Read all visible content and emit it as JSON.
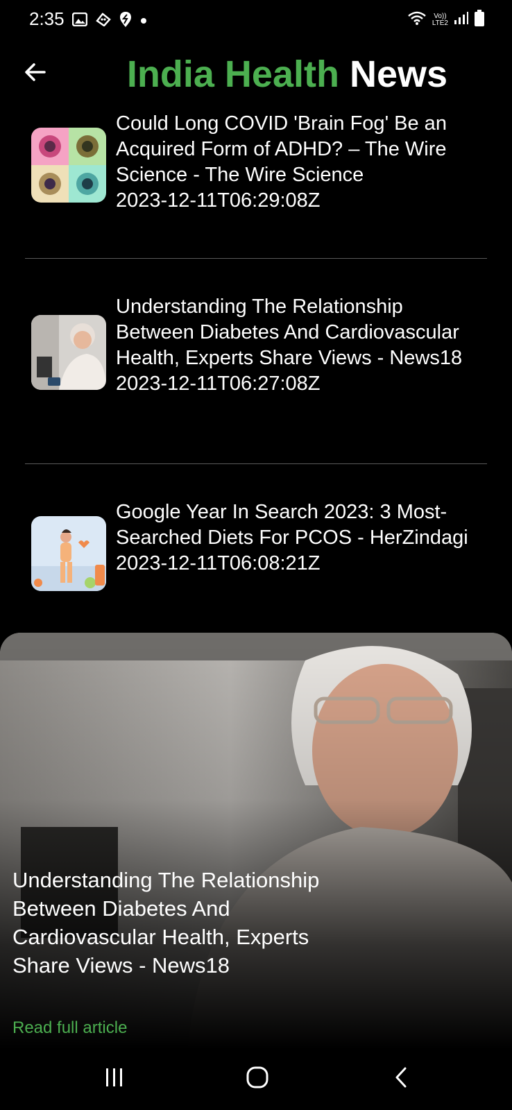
{
  "status_bar": {
    "time": "2:35",
    "network": "LTE2",
    "volte": "Vo))",
    "icons_left": [
      "gallery-icon",
      "discord-icon",
      "swiggy-icon",
      "dot-icon"
    ],
    "icons_right": [
      "wifi-icon",
      "signal-icon",
      "battery-icon"
    ]
  },
  "header": {
    "title_part1": "India Health",
    "title_part2": "News",
    "back_icon": "arrow-left-icon"
  },
  "news": [
    {
      "title": "Could Long COVID 'Brain Fog' Be an Acquired Form of ADHD? – The Wire Science - The Wire Science",
      "date": "2023-12-11T06:29:08Z"
    },
    {
      "title": "Understanding The Relationship Between Diabetes And Cardiovascular Health, Experts Share Views - News18",
      "date": "2023-12-11T06:27:08Z"
    },
    {
      "title": "Google Year In Search 2023: 3 Most-Searched Diets For PCOS - HerZindagi",
      "date": "2023-12-11T06:08:21Z"
    }
  ],
  "featured": {
    "title": "Understanding The Relationship Between Diabetes And Cardiovascular Health, Experts Share Views - News18",
    "read_more": "Read full article"
  },
  "colors": {
    "accent": "#4caf50",
    "background": "#000000",
    "divider": "#5a5a5a"
  },
  "nav": {
    "buttons": [
      "recents-icon",
      "home-icon",
      "back-icon"
    ]
  }
}
